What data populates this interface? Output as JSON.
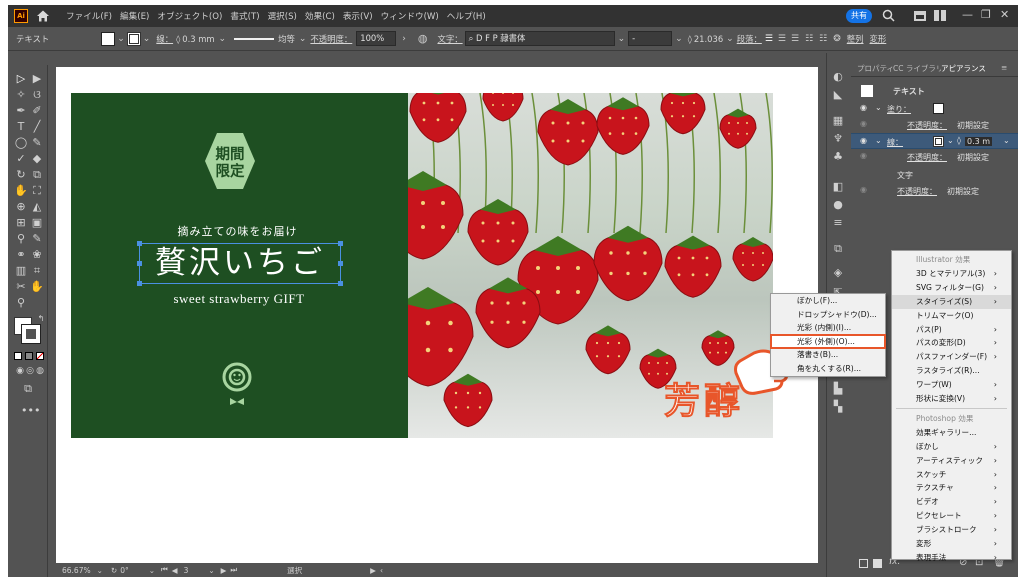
{
  "app": {
    "logo": "Ai",
    "menus": [
      "ファイル(F)",
      "編集(E)",
      "オブジェクト(O)",
      "書式(T)",
      "選択(S)",
      "効果(C)",
      "表示(V)",
      "ウィンドウ(W)",
      "ヘルプ(H)"
    ],
    "share_label": "共有"
  },
  "control_bar": {
    "selection_type": "テキスト",
    "stroke_label": "線：",
    "stroke_value": "0.3 mm",
    "profile_label": "均等",
    "opacity_label": "不透明度：",
    "opacity_value": "100%",
    "char_label": "文字：",
    "font_name": "D F P 隷書体",
    "font_style": "-",
    "font_size": "21.036",
    "para_label": "段落：",
    "align_label": "整列",
    "transform_label": "変形"
  },
  "canvas": {
    "badge_lines": [
      "期間",
      "限定"
    ],
    "tagline": "摘み立ての味をお届け",
    "headline": "贅沢いちご",
    "subheadline": "sweet strawberry GIFT",
    "stamp_text": "芳醇"
  },
  "status_bar": {
    "zoom": "66.67%",
    "rotation": "0°",
    "artboard": "3",
    "tool": "選択"
  },
  "panel": {
    "tabs": [
      "プロパティ",
      "CC ライブラリ",
      "アピアランス"
    ],
    "rows": [
      {
        "label": "テキスト"
      },
      {
        "label": "塗り："
      },
      {
        "label": "不透明度：",
        "value": "初期設定"
      },
      {
        "label": "線：",
        "value": "0.3 m"
      },
      {
        "label": "不透明度：",
        "value": "初期設定"
      },
      {
        "label": "文字"
      },
      {
        "label": "不透明度：",
        "value": "初期設定"
      }
    ],
    "fx": "fx."
  },
  "stylize_menu": [
    "ぼかし(F)...",
    "ドロップシャドウ(D)...",
    "光彩 (内側)(I)...",
    "光彩 (外側)(O)...",
    "落書き(B)...",
    "角を丸くする(R)..."
  ],
  "effect_menu": {
    "illustrator_header": "Illustrator 効果",
    "illustrator_items": [
      {
        "label": "3D とマテリアル(3)",
        "sub": true
      },
      {
        "label": "SVG フィルター(G)",
        "sub": true
      },
      {
        "label": "スタイライズ(S)",
        "sub": true
      },
      {
        "label": "トリムマーク(O)",
        "sub": false
      },
      {
        "label": "パス(P)",
        "sub": true
      },
      {
        "label": "パスの変形(D)",
        "sub": true
      },
      {
        "label": "パスファインダー(F)",
        "sub": true
      },
      {
        "label": "ラスタライズ(R)...",
        "sub": false
      },
      {
        "label": "ワープ(W)",
        "sub": true
      },
      {
        "label": "形状に変換(V)",
        "sub": true
      }
    ],
    "photoshop_header": "Photoshop 効果",
    "photoshop_items": [
      {
        "label": "効果ギャラリー...",
        "sub": false
      },
      {
        "label": "ぼかし",
        "sub": true
      },
      {
        "label": "アーティスティック",
        "sub": true
      },
      {
        "label": "スケッチ",
        "sub": true
      },
      {
        "label": "テクスチャ",
        "sub": true
      },
      {
        "label": "ビデオ",
        "sub": true
      },
      {
        "label": "ピクセレート",
        "sub": true
      },
      {
        "label": "ブラシストローク",
        "sub": true
      },
      {
        "label": "変形",
        "sub": true
      },
      {
        "label": "表現手法",
        "sub": true
      }
    ]
  },
  "colors": {
    "accent": "#e8562a",
    "green": "#1e4f22",
    "chrome": "#535353",
    "selection": "#1473e6"
  }
}
